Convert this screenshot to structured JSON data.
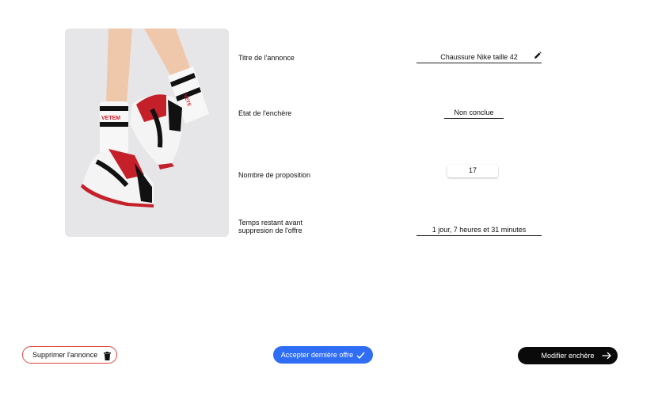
{
  "listing": {
    "image_alt": "Sneakers Nike rouges et noires avec chaussettes",
    "fields": {
      "title_label": "Titre de l'annonce",
      "title_value": "Chaussure Nike taille 42",
      "state_label": "Etat de l'enchère",
      "state_value": "Non conclue",
      "count_label": "Nombre de proposition",
      "count_value": "17",
      "time_label_line1": "Temps restant avant",
      "time_label_line2": "suppresion de l'offre",
      "time_value": "1 jour, 7 heures et 31 minutes"
    },
    "icons": {
      "edit": "pencil-icon",
      "delete": "trash-icon",
      "accept": "check-icon",
      "modify": "arrow-right-icon"
    }
  },
  "actions": {
    "delete_label": "Supprimer l'annonce",
    "accept_label": "Accepter dernière offre",
    "modify_label": "Modifier enchère"
  },
  "colors": {
    "accent_blue": "#2f6df5",
    "danger_red": "#e0473f",
    "dark_button": "#0a0a0a"
  }
}
